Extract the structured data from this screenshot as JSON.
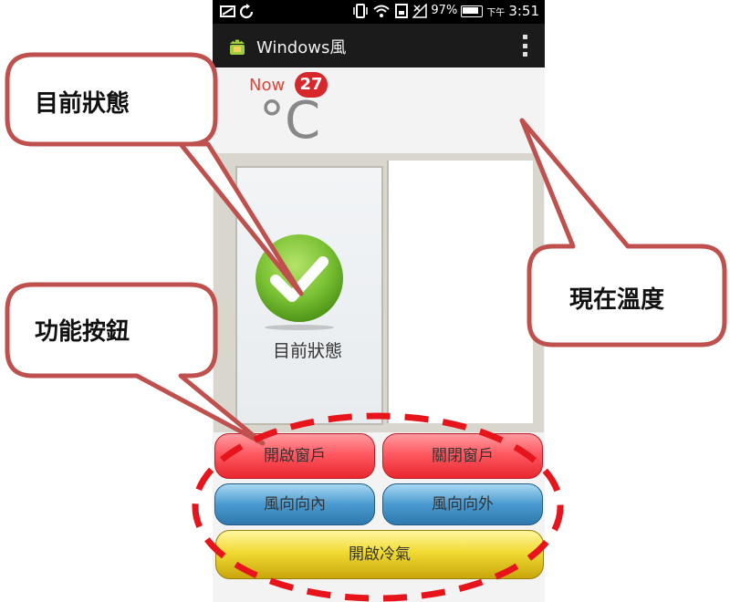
{
  "statusbar": {
    "battery_percent": "97%",
    "ampm": "下午",
    "time": "3:51",
    "icons": [
      "screenshot-icon",
      "sync-icon",
      "vibrate-icon",
      "wifi-icon",
      "sim-icon",
      "signal-icon",
      "battery-icon"
    ]
  },
  "actionbar": {
    "title": "Windows風",
    "app_icon": "android-icon",
    "menu_icon": "overflow-menu-icon"
  },
  "temperature": {
    "now_label": "Now",
    "value": "27",
    "unit": "°C"
  },
  "window": {
    "status_label": "目前狀態",
    "status_icon": "check-icon"
  },
  "buttons": {
    "open_window": "開啟窗戶",
    "close_window": "關閉窗戶",
    "wind_in": "風向向內",
    "wind_out": "風向向外",
    "open_ac": "開啟冷氣"
  },
  "callouts": {
    "current_status": "目前狀態",
    "function_buttons": "功能按鈕",
    "current_temperature": "現在溫度"
  },
  "colors": {
    "callout_border": "#c0504d",
    "dashed_ellipse": "#e8141c",
    "red_button": "#ff5a62",
    "blue_button": "#4a9ad0",
    "yellow_button": "#f1db33",
    "check_green": "#7cc235",
    "temp_badge": "#d9262b"
  }
}
